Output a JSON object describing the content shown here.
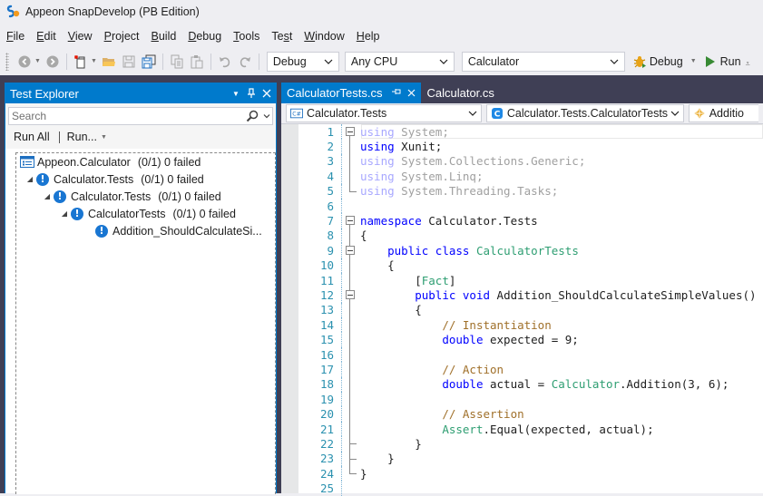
{
  "window": {
    "title": "Appeon SnapDevelop (PB Edition)"
  },
  "menu": [
    {
      "label": "File",
      "accel": "F",
      "rest": "ile"
    },
    {
      "label": "Edit",
      "accel": "E",
      "rest": "dit"
    },
    {
      "label": "View",
      "accel": "V",
      "rest": "iew"
    },
    {
      "label": "Project",
      "accel": "P",
      "rest": "roject"
    },
    {
      "label": "Build",
      "accel": "B",
      "rest": "uild"
    },
    {
      "label": "Debug",
      "accel": "D",
      "rest": "ebug"
    },
    {
      "label": "Tools",
      "accel": "T",
      "rest": "ools"
    },
    {
      "label": "Test",
      "pre": "Te",
      "accel": "s",
      "rest": "t"
    },
    {
      "label": "Window",
      "accel": "W",
      "rest": "indow"
    },
    {
      "label": "Help",
      "accel": "H",
      "rest": "elp"
    }
  ],
  "toolbar": {
    "icons": [
      "back-icon",
      "forward-icon",
      "new-project-icon",
      "open-folder-icon",
      "save-icon",
      "save-all-icon",
      "copy-icon",
      "paste-icon",
      "undo-icon",
      "redo-icon"
    ],
    "config": "Debug",
    "platform": "Any CPU",
    "startup_project": "Calculator",
    "debug_label": "Debug",
    "run_label": "Run"
  },
  "test_explorer": {
    "title": "Test Explorer",
    "search_placeholder": "Search",
    "run_all": "Run All",
    "run": "Run...",
    "tree": [
      {
        "label": "Appeon.Calculator",
        "count": "(0/1) 0 failed",
        "level": 0,
        "icon": "project-icon"
      },
      {
        "label": "Calculator.Tests",
        "count": "(0/1) 0 failed",
        "level": 1,
        "icon": "warning-icon"
      },
      {
        "label": "Calculator.Tests",
        "count": "(0/1) 0 failed",
        "level": 2,
        "icon": "warning-icon"
      },
      {
        "label": "CalculatorTests",
        "count": "(0/1) 0 failed",
        "level": 3,
        "icon": "warning-icon"
      },
      {
        "label": "Addition_ShouldCalculateSi...",
        "count": "",
        "level": 4,
        "icon": "warning-icon"
      }
    ]
  },
  "editor": {
    "tabs": [
      {
        "label": "CalculatorTests.cs",
        "active": true
      },
      {
        "label": "Calculator.cs",
        "active": false
      }
    ],
    "nav": {
      "project": "Calculator.Tests",
      "type": "Calculator.Tests.CalculatorTests",
      "member": "Additio"
    },
    "lines": [
      {
        "n": "1"
      },
      {
        "n": "2"
      },
      {
        "n": "3"
      },
      {
        "n": "4"
      },
      {
        "n": "5"
      },
      {
        "n": "6"
      },
      {
        "n": "7"
      },
      {
        "n": "8"
      },
      {
        "n": "9"
      },
      {
        "n": "10"
      },
      {
        "n": "11"
      },
      {
        "n": "12"
      },
      {
        "n": "13"
      },
      {
        "n": "14"
      },
      {
        "n": "15"
      },
      {
        "n": "16"
      },
      {
        "n": "17"
      },
      {
        "n": "18"
      },
      {
        "n": "19"
      },
      {
        "n": "20"
      },
      {
        "n": "21"
      },
      {
        "n": "22"
      },
      {
        "n": "23"
      },
      {
        "n": "24"
      },
      {
        "n": "25"
      }
    ],
    "code": {
      "using": "using",
      "l1": " System;",
      "l2": " Xunit;",
      "l3": " System.Collections.Generic;",
      "l4": " System.Linq;",
      "l5": " System.Threading.Tasks;",
      "namespace": "namespace",
      "l7": " Calculator.Tests",
      "open_brace": "{",
      "close_brace": "}",
      "public": "public",
      "class": "class",
      "class_name": "CalculatorTests",
      "fact_open": "[",
      "fact": "Fact",
      "fact_close": "]",
      "void": "void",
      "method": " Addition_ShouldCalculateSimpleValues()",
      "c1": "// Instantiation",
      "double": "double",
      "l15": " expected = 9;",
      "c2": "// Action",
      "l18a": " actual = ",
      "calc": "Calculator",
      "l18b": ".Addition(3, 6);",
      "c3": "// Assertion",
      "assert": "Assert",
      "l21": ".Equal(expected, actual);"
    }
  }
}
